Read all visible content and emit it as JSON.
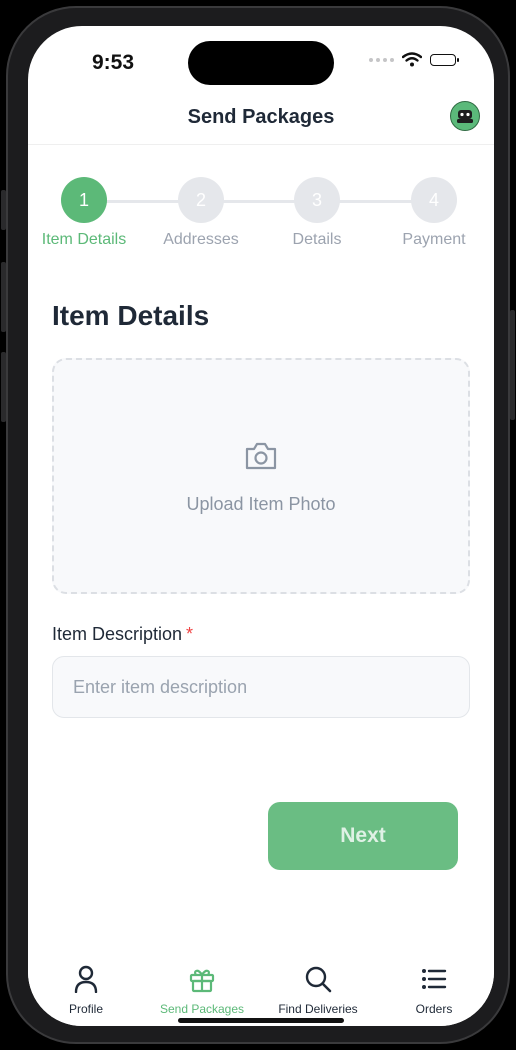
{
  "status_bar": {
    "time": "9:53"
  },
  "header": {
    "title": "Send Packages"
  },
  "stepper": {
    "steps": [
      {
        "number": "1",
        "label": "Item Details",
        "state": "active"
      },
      {
        "number": "2",
        "label": "Addresses",
        "state": "inactive"
      },
      {
        "number": "3",
        "label": "Details",
        "state": "inactive"
      },
      {
        "number": "4",
        "label": "Payment",
        "state": "inactive"
      }
    ]
  },
  "form": {
    "section_title": "Item Details",
    "upload_label": "Upload Item Photo",
    "upload_icon": "camera-icon",
    "description_label": "Item Description",
    "required_marker": "*",
    "description_placeholder": "Enter item description",
    "description_value": "",
    "next_label": "Next"
  },
  "tab_bar": {
    "tabs": [
      {
        "label": "Profile",
        "icon": "person-icon"
      },
      {
        "label": "Send Packages",
        "icon": "gift-icon",
        "active": true
      },
      {
        "label": "Find Deliveries",
        "icon": "search-icon"
      },
      {
        "label": "Orders",
        "icon": "list-icon"
      }
    ]
  },
  "colors": {
    "accent": "#5cb978",
    "button": "#6abd83",
    "inactive": "#e5e7eb",
    "required": "#ef4444"
  }
}
